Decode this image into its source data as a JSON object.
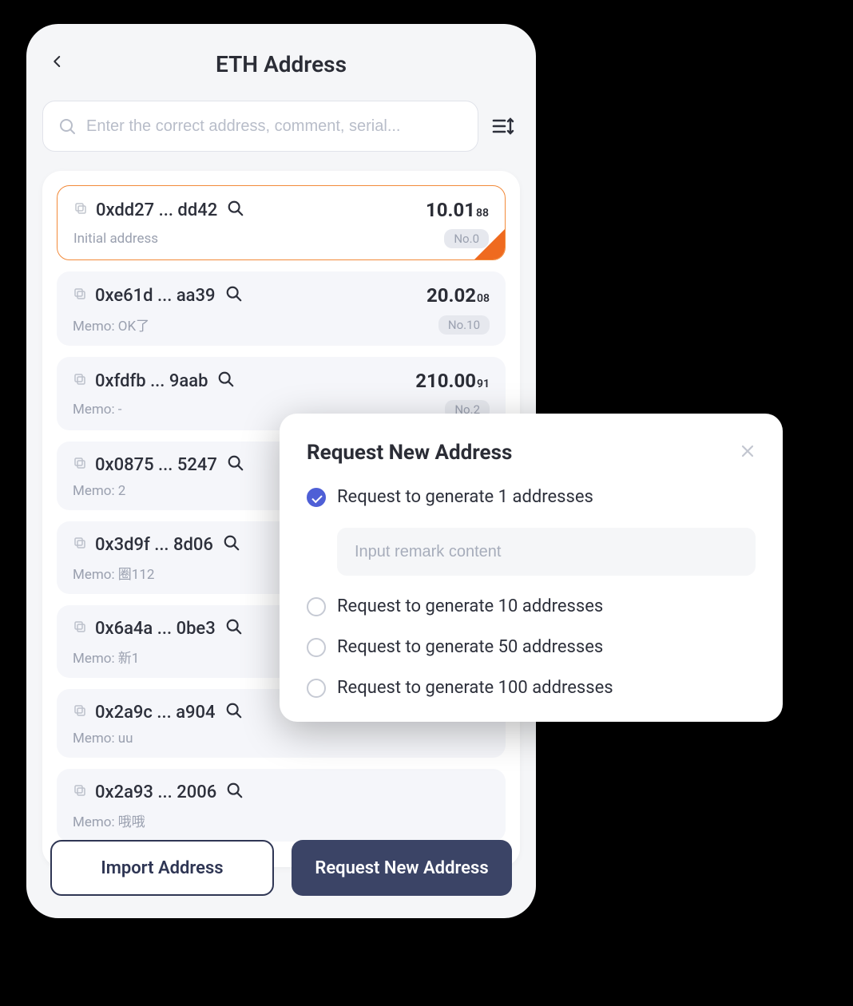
{
  "header": {
    "title": "ETH Address"
  },
  "search": {
    "placeholder": "Enter the correct address, comment, serial..."
  },
  "addresses": [
    {
      "addr": "0xdd27 ... dd42",
      "balance_main": "10.01",
      "balance_sub": "88",
      "memo": "Initial address",
      "badge": "No.0",
      "selected": true
    },
    {
      "addr": "0xe61d ... aa39",
      "balance_main": "20.02",
      "balance_sub": "08",
      "memo": "Memo: OK了",
      "badge": "No.10",
      "selected": false
    },
    {
      "addr": "0xfdfb ... 9aab",
      "balance_main": "210.00",
      "balance_sub": "91",
      "memo": "Memo: -",
      "badge": "No.2",
      "selected": false
    },
    {
      "addr": "0x0875 ... 5247",
      "balance_main": "",
      "balance_sub": "",
      "memo": "Memo: 2",
      "badge": "",
      "selected": false
    },
    {
      "addr": "0x3d9f ... 8d06",
      "balance_main": "",
      "balance_sub": "",
      "memo": "Memo: 圈112",
      "badge": "",
      "selected": false
    },
    {
      "addr": "0x6a4a ... 0be3",
      "balance_main": "",
      "balance_sub": "",
      "memo": "Memo: 新1",
      "badge": "",
      "selected": false
    },
    {
      "addr": "0x2a9c ... a904",
      "balance_main": "",
      "balance_sub": "",
      "memo": "Memo: uu",
      "badge": "",
      "selected": false
    },
    {
      "addr": "0x2a93 ... 2006",
      "balance_main": "",
      "balance_sub": "",
      "memo": "Memo: 哦哦",
      "badge": "",
      "selected": false
    }
  ],
  "footer": {
    "import_label": "Import Address",
    "request_label": "Request New Address"
  },
  "modal": {
    "title": "Request New Address",
    "remark_placeholder": "Input remark content",
    "options": [
      {
        "label": "Request to generate 1 addresses",
        "checked": true
      },
      {
        "label": "Request to generate 10 addresses",
        "checked": false
      },
      {
        "label": "Request to generate 50 addresses",
        "checked": false
      },
      {
        "label": "Request to generate 100 addresses",
        "checked": false
      }
    ]
  }
}
